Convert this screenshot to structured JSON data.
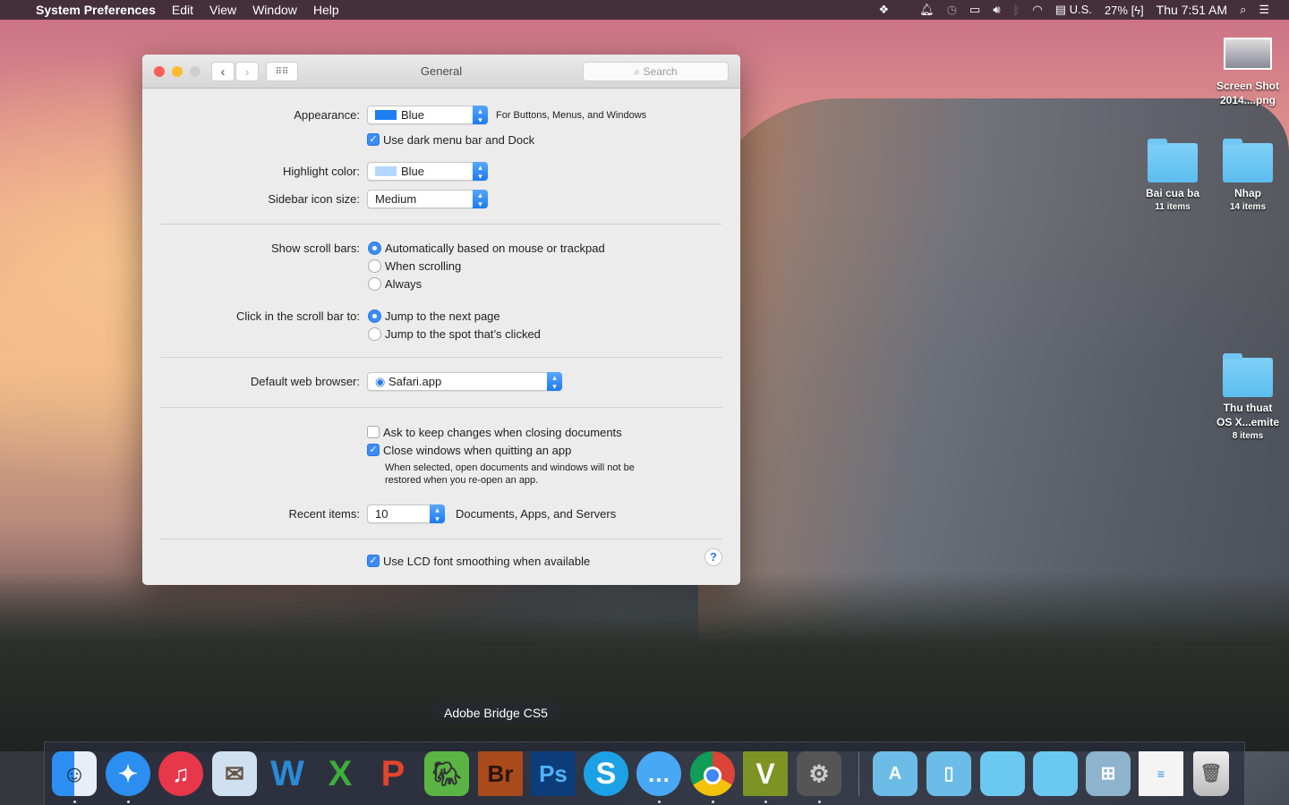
{
  "menubar": {
    "app": "System Preferences",
    "items": [
      "Edit",
      "View",
      "Window",
      "Help"
    ],
    "input_source": "U.S.",
    "battery": "27%",
    "clock": "Thu 7:51 AM"
  },
  "window": {
    "title": "General",
    "search_placeholder": "Search",
    "appearance": {
      "label": "Appearance:",
      "value": "Blue",
      "swatch": "#1f7ef3",
      "note": "For Buttons, Menus, and Windows"
    },
    "dark_menu": {
      "label": "Use dark menu bar and Dock",
      "checked": true
    },
    "highlight": {
      "label": "Highlight color:",
      "value": "Blue",
      "swatch": "#b3d7ff"
    },
    "sidebar_size": {
      "label": "Sidebar icon size:",
      "value": "Medium"
    },
    "scroll_bars": {
      "label": "Show scroll bars:",
      "options": [
        "Automatically based on mouse or trackpad",
        "When scrolling",
        "Always"
      ],
      "selected": 0
    },
    "click_scroll": {
      "label": "Click in the scroll bar to:",
      "options": [
        "Jump to the next page",
        "Jump to the spot that’s clicked"
      ],
      "selected": 0
    },
    "browser": {
      "label": "Default web browser:",
      "value": "Safari.app"
    },
    "ask_keep": {
      "label": "Ask to keep changes when closing documents",
      "checked": false
    },
    "close_windows": {
      "label": "Close windows when quitting an app",
      "checked": true,
      "note1": "When selected, open documents and windows will not be",
      "note2": "restored when you re-open an app."
    },
    "recent": {
      "label": "Recent items:",
      "value": "10",
      "note": "Documents, Apps, and Servers"
    },
    "lcd": {
      "label": "Use LCD font smoothing when available",
      "checked": true
    },
    "help": "?"
  },
  "desktop": [
    {
      "name": "Screen Shot",
      "name2": "2014....png"
    },
    {
      "name": "Bai cua ba",
      "sub": "11 items"
    },
    {
      "name": "Nhap",
      "sub": "14 items"
    },
    {
      "name": "Thu thuat",
      "name2": "OS X...emite",
      "sub": "8 items"
    }
  ],
  "dock": {
    "tooltip": "Adobe Bridge CS5",
    "apps": [
      "Finder",
      "Safari",
      "iTunes",
      "Preview",
      "Word",
      "Excel",
      "PowerPoint",
      "Evernote",
      "Adobe Bridge CS5",
      "Photoshop",
      "Skype",
      "Messages",
      "Chrome",
      "Vectorworks",
      "System Preferences",
      "Applications",
      "Documents",
      "Folder",
      "Folder",
      "Windows",
      "Safari Document",
      "Trash"
    ]
  }
}
